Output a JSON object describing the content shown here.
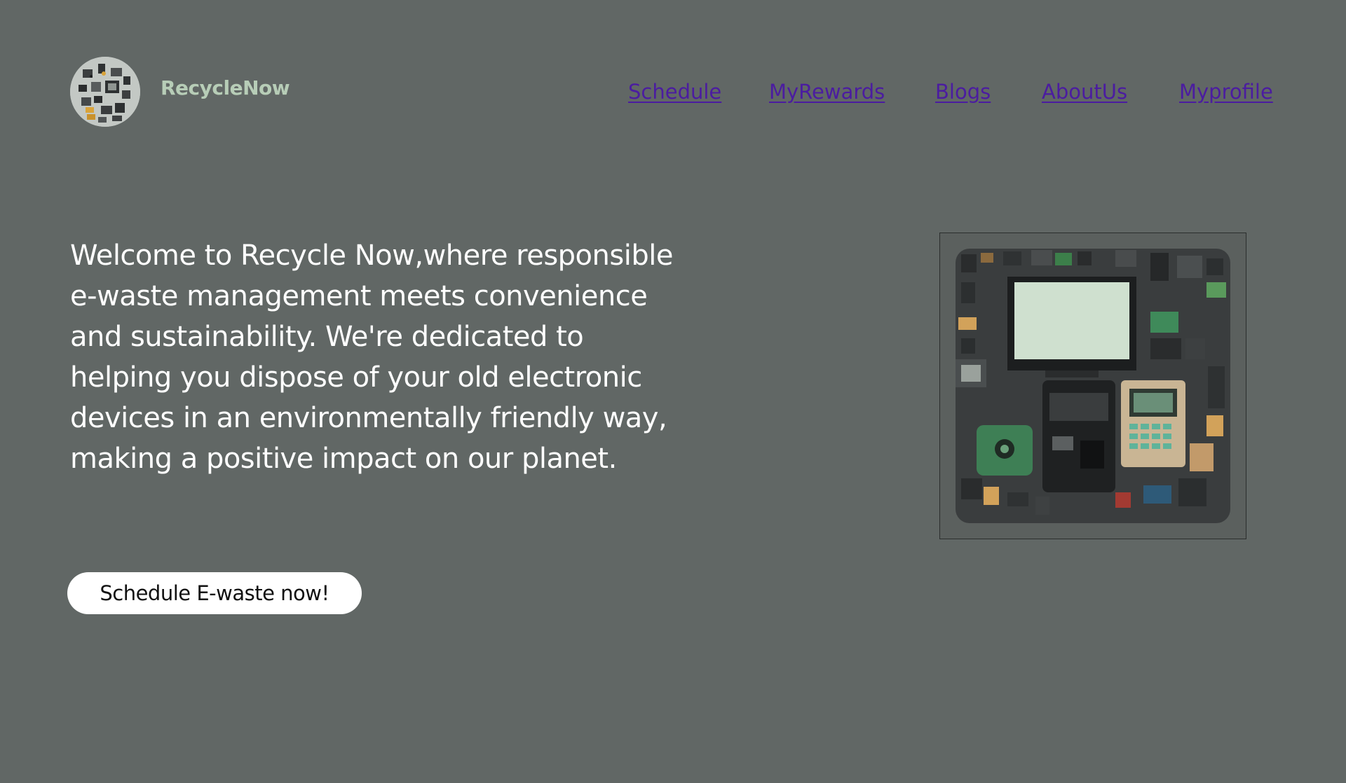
{
  "header": {
    "brand": "RecycleNow",
    "nav": [
      {
        "label": "Schedule"
      },
      {
        "label": "MyRewards"
      },
      {
        "label": "Blogs"
      },
      {
        "label": "AboutUs"
      },
      {
        "label": "Myprofile"
      }
    ]
  },
  "hero": {
    "text": "Welcome to Recycle Now,where responsible e-waste management meets convenience and sustainability. We're dedicated to helping you dispose of your old electronic devices in an environmentally friendly way, making a positive impact on our planet.",
    "cta_label": "Schedule E-waste now!"
  },
  "colors": {
    "background": "#616765",
    "brand_text": "#b7cdb7",
    "nav_link": "#4b1ca0",
    "hero_text": "#ffffff",
    "cta_background": "#ffffff"
  }
}
